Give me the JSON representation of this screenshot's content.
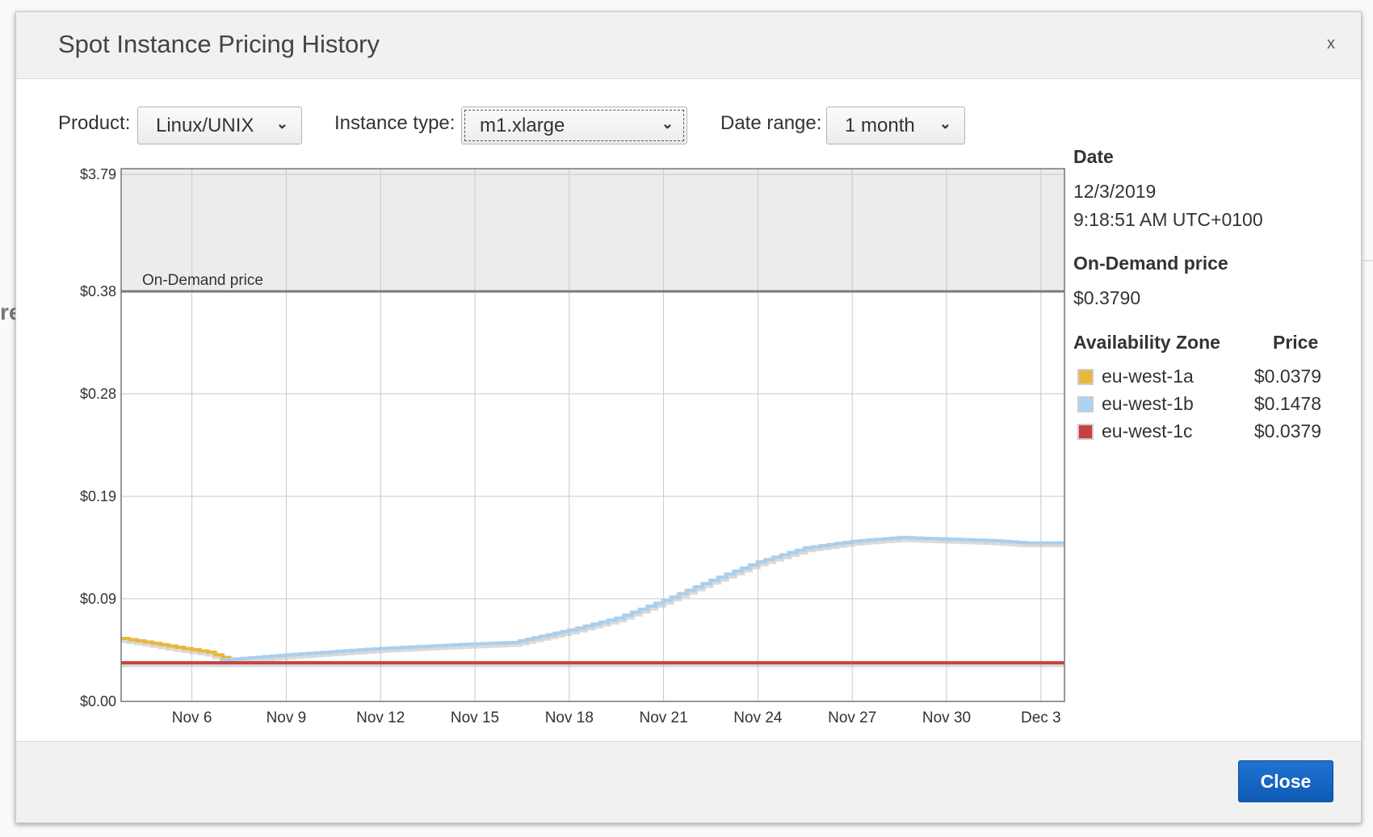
{
  "background": {
    "fragment_text": "re"
  },
  "modal": {
    "title": "Spot Instance Pricing History",
    "close_x": "x",
    "close_button": "Close"
  },
  "filters": {
    "product_label": "Product:",
    "product_value": "Linux/UNIX",
    "instance_type_label": "Instance type:",
    "instance_type_value": "m1.xlarge",
    "date_range_label": "Date range:",
    "date_range_value": "1 month"
  },
  "chart_data": {
    "type": "line",
    "on_demand_label": "On-Demand price",
    "on_demand_value": 0.379,
    "y_ticks": [
      {
        "label": "$0.00",
        "value": 0
      },
      {
        "label": "$0.09",
        "value": 0.0948
      },
      {
        "label": "$0.19",
        "value": 0.1895
      },
      {
        "label": "$0.28",
        "value": 0.2843
      },
      {
        "label": "$0.38",
        "value": 0.379
      },
      {
        "label": "$3.79",
        "value": 3.79
      }
    ],
    "x_ticks": [
      "Nov 6",
      "Nov 9",
      "Nov 12",
      "Nov 15",
      "Nov 18",
      "Nov 21",
      "Nov 24",
      "Nov 27",
      "Nov 30",
      "Dec 3"
    ],
    "x_tick_days": [
      6,
      9,
      12,
      15,
      18,
      21,
      24,
      27,
      30,
      33
    ],
    "x_range_days": [
      3.75,
      33.75
    ],
    "grid": true,
    "series": [
      {
        "name": "eu-west-1a",
        "color": "#e8b83a",
        "points": [
          [
            3.75,
            0.0582
          ],
          [
            4.5,
            0.0548
          ],
          [
            5.5,
            0.05
          ],
          [
            6.5,
            0.0455
          ],
          [
            7.2,
            0.0382
          ]
        ]
      },
      {
        "name": "eu-west-1b",
        "color": "#a9cfee",
        "points": [
          [
            6.9,
            0.0382
          ],
          [
            9,
            0.043
          ],
          [
            12,
            0.049
          ],
          [
            15,
            0.0532
          ],
          [
            16.2,
            0.0545
          ],
          [
            18,
            0.066
          ],
          [
            19.5,
            0.077
          ],
          [
            21,
            0.0935
          ],
          [
            22.5,
            0.112
          ],
          [
            24,
            0.129
          ],
          [
            25.5,
            0.142
          ],
          [
            27,
            0.148
          ],
          [
            28.5,
            0.1515
          ],
          [
            30,
            0.15
          ],
          [
            31.5,
            0.1485
          ],
          [
            32.5,
            0.1465
          ],
          [
            33.75,
            0.1465
          ]
        ]
      },
      {
        "name": "eu-west-1c",
        "color": "#c94040",
        "points": [
          [
            3.75,
            0.0357
          ],
          [
            33.75,
            0.0357
          ]
        ]
      }
    ]
  },
  "info": {
    "date_heading": "Date",
    "date_value": "12/3/2019",
    "time_value": "9:18:51 AM UTC+0100",
    "on_demand_heading": "On-Demand price",
    "on_demand_value": "$0.3790",
    "zone_heading": "Availability Zone",
    "price_heading": "Price",
    "zones": [
      {
        "name": "eu-west-1a",
        "price": "$0.0379",
        "color": "#e8b83a"
      },
      {
        "name": "eu-west-1b",
        "price": "$0.1478",
        "color": "#aad3f5"
      },
      {
        "name": "eu-west-1c",
        "price": "$0.0379",
        "color": "#c94040"
      }
    ]
  }
}
